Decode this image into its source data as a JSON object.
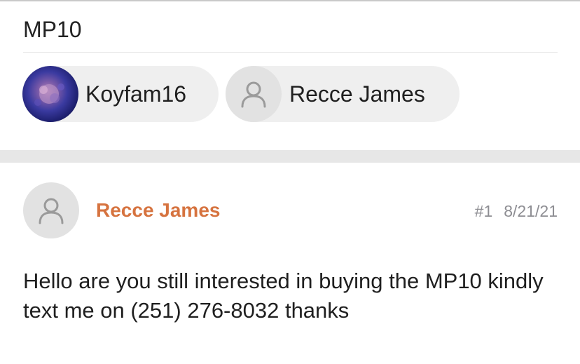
{
  "conversation": {
    "title": "MP10",
    "participants": [
      {
        "name": "Koyfam16",
        "avatar": "coral-photo"
      },
      {
        "name": "Recce James",
        "avatar": "user-icon"
      }
    ]
  },
  "message": {
    "author": "Recce James",
    "number": "#1",
    "date": "8/21/21",
    "body": "Hello are you still interested in buying the MP10 kindly text me on (251) 276-8032 thanks",
    "avatar": "user-icon"
  },
  "colors": {
    "author_accent": "#d6733f",
    "chip_bg": "#efefef",
    "meta_gray": "#8e8e93"
  }
}
